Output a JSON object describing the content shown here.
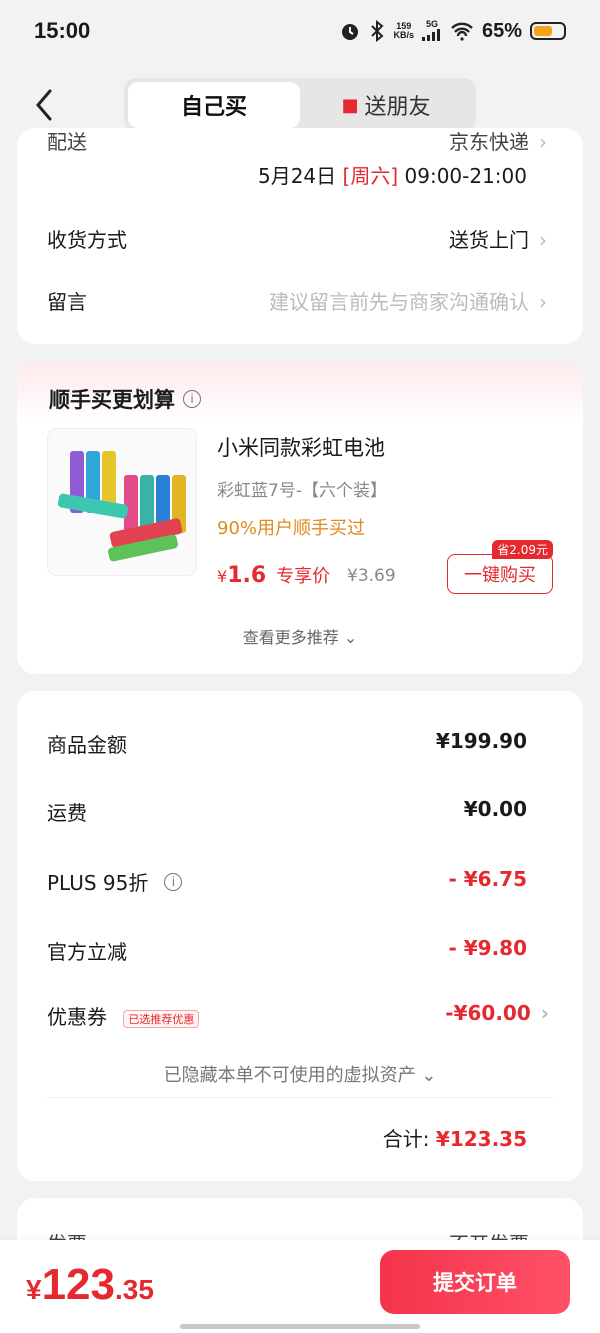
{
  "status_bar": {
    "time": "15:00",
    "net_speed_value": "159",
    "net_speed_unit": "KB/s",
    "network": "5G",
    "battery_percent": "65%",
    "battery_level": 0.65,
    "icons": [
      "alarm-icon",
      "bluetooth-icon",
      "signal-icon",
      "wifi-icon",
      "battery-icon"
    ]
  },
  "header": {
    "tabs": [
      {
        "label": "自己买",
        "active": true
      },
      {
        "label": "送朋友",
        "active": false
      }
    ]
  },
  "delivery_card": {
    "cut_label": "配送",
    "cut_value": "京东快递",
    "date": "5月24日",
    "weekday": "[周六]",
    "time_range": "09:00-21:00",
    "receive_label": "收货方式",
    "receive_value": "送货上门",
    "message_label": "留言",
    "message_placeholder": "建议留言前先与商家沟通确认"
  },
  "recommend_card": {
    "title": "顺手买更划算",
    "product_name": "小米同款彩虹电池",
    "spec": "彩虹蓝7号-【六个装】",
    "tag": "90%用户顺手买过",
    "price_symbol": "¥",
    "price": "1.6",
    "price_label": "专享价",
    "original_price": "¥3.69",
    "save_badge": "省2.09元",
    "buy_button": "一键购买",
    "more": "查看更多推荐"
  },
  "fee_card": {
    "rows": [
      {
        "label": "商品金额",
        "value": "¥199.90",
        "red": false
      },
      {
        "label": "运费",
        "value": "¥0.00",
        "red": false
      },
      {
        "label": "PLUS 95折",
        "value": "- ¥6.75",
        "red": true
      },
      {
        "label": "官方立减",
        "value": "- ¥9.80",
        "red": true
      },
      {
        "label": "优惠券",
        "value": "-¥60.00",
        "red": true
      }
    ],
    "coupon_tag": "已选推荐优惠",
    "hidden_assets": "已隐藏本单不可使用的虚拟资产",
    "total_label": "合计:",
    "total_value": "¥123.35"
  },
  "invoice_card": {
    "cut_label": "发票",
    "cut_value": "不开发票"
  },
  "bottom_bar": {
    "yen": "¥",
    "int": "123",
    "dec": ".35",
    "submit": "提交订单"
  },
  "colors": {
    "accent_red": "#e5292e",
    "orange_tag": "#e08a1e"
  }
}
